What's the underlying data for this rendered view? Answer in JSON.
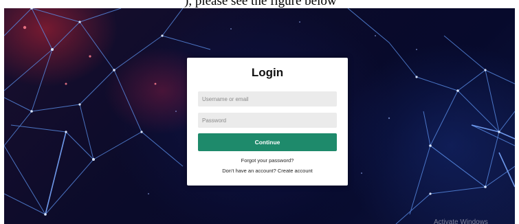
{
  "page_caption": "), please see the figure below",
  "login": {
    "title": "Login",
    "username_placeholder": "Username or email",
    "password_placeholder": "Password",
    "continue_label": "Continue",
    "forgot_label": "Forgot your password?",
    "no_account_text": "Don't have an account?",
    "create_account_label": "Create account"
  },
  "watermark": "Activate Windows",
  "colors": {
    "continue_button": "#1e8a6b",
    "field_background": "#ebebeb",
    "background_dark": "#0b0b2a",
    "network_lines": "#4a7fd8"
  }
}
